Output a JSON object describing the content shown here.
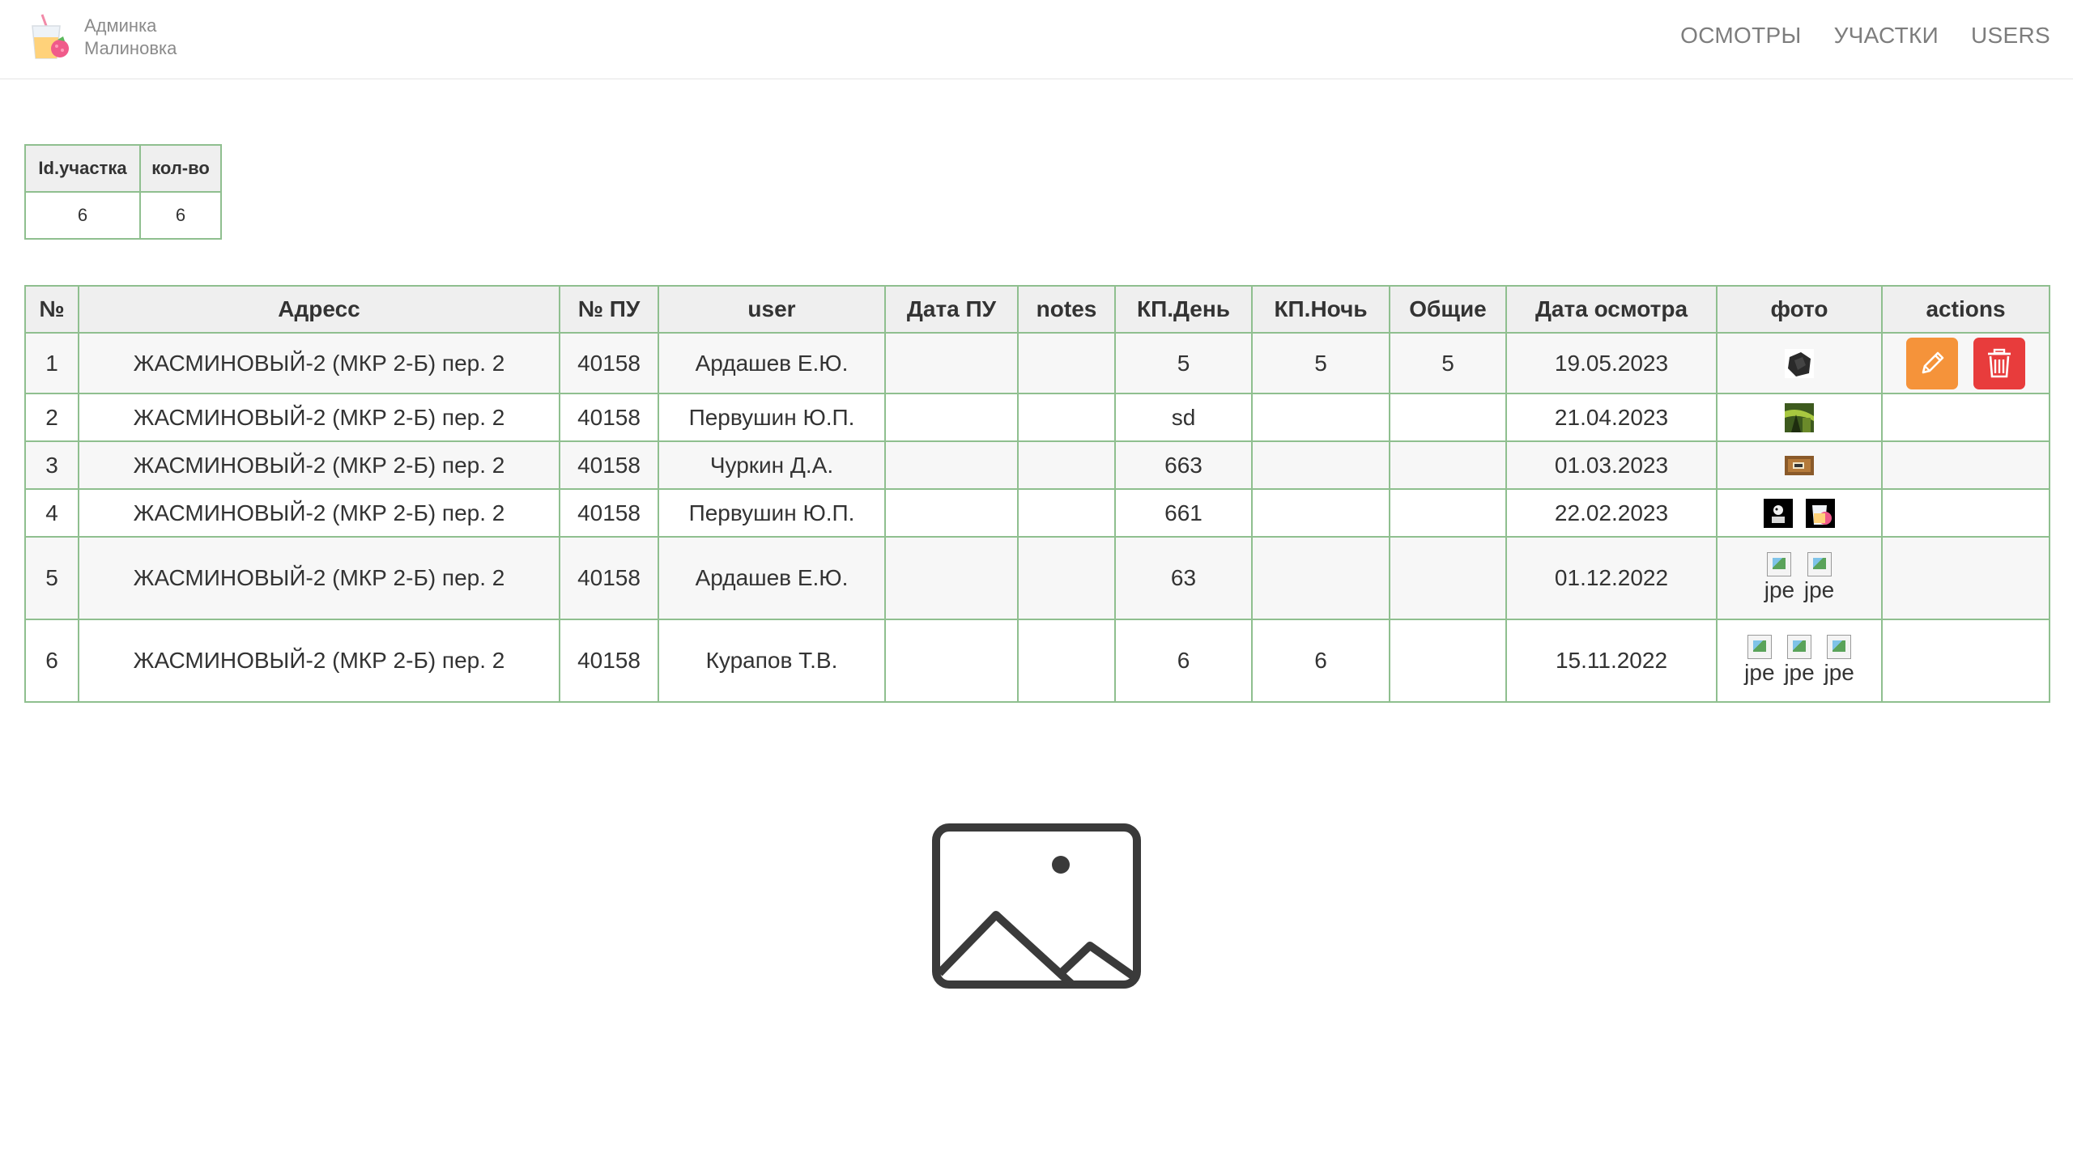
{
  "brand": {
    "line1": "Админка",
    "line2": "Малиновка",
    "logo_icon": "juice-glass-raspberry-icon"
  },
  "nav": {
    "items": [
      "ОСМОТРЫ",
      "УЧАСТКИ",
      "USERS"
    ]
  },
  "summary": {
    "headers": [
      "Id.участка",
      "кол-во"
    ],
    "row": [
      "6",
      "6"
    ]
  },
  "table": {
    "headers": [
      "№",
      "Адресс",
      "№ ПУ",
      "user",
      "Дата ПУ",
      "notes",
      "КП.День",
      "КП.Ночь",
      "Общие",
      "Дата осмотра",
      "фото",
      "actions"
    ],
    "rows": [
      {
        "n": "1",
        "address": "ЖАСМИНОВЫЙ-2 (МКР 2-Б) пер. 2",
        "pu": "40158",
        "user": "Ардашев Е.Ю.",
        "date_pu": "",
        "notes": "",
        "kp_day": "5",
        "kp_night": "5",
        "common": "5",
        "date": "19.05.2023"
      },
      {
        "n": "2",
        "address": "ЖАСМИНОВЫЙ-2 (МКР 2-Б) пер. 2",
        "pu": "40158",
        "user": "Первушин Ю.П.",
        "date_pu": "",
        "notes": "",
        "kp_day": "sd",
        "kp_night": "",
        "common": "",
        "date": "21.04.2023"
      },
      {
        "n": "3",
        "address": "ЖАСМИНОВЫЙ-2 (МКР 2-Б) пер. 2",
        "pu": "40158",
        "user": "Чуркин Д.А.",
        "date_pu": "",
        "notes": "",
        "kp_day": "663",
        "kp_night": "",
        "common": "",
        "date": "01.03.2023"
      },
      {
        "n": "4",
        "address": "ЖАСМИНОВЫЙ-2 (МКР 2-Б) пер. 2",
        "pu": "40158",
        "user": "Первушин Ю.П.",
        "date_pu": "",
        "notes": "",
        "kp_day": "661",
        "kp_night": "",
        "common": "",
        "date": "22.02.2023"
      },
      {
        "n": "5",
        "address": "ЖАСМИНОВЫЙ-2 (МКР 2-Б) пер. 2",
        "pu": "40158",
        "user": "Ардашев Е.Ю.",
        "date_pu": "",
        "notes": "",
        "kp_day": "63",
        "kp_night": "",
        "common": "",
        "date": "01.12.2022"
      },
      {
        "n": "6",
        "address": "ЖАСМИНОВЫЙ-2 (МКР 2-Б) пер. 2",
        "pu": "40158",
        "user": "Курапов Т.В.",
        "date_pu": "",
        "notes": "",
        "kp_day": "6",
        "kp_night": "6",
        "common": "",
        "date": "15.11.2022"
      }
    ],
    "broken_image_label": "jpe"
  },
  "colors": {
    "border": "#8fbf8f",
    "edit": "#f5933a",
    "delete": "#e83c3c",
    "nav": "#7d7d7d"
  }
}
